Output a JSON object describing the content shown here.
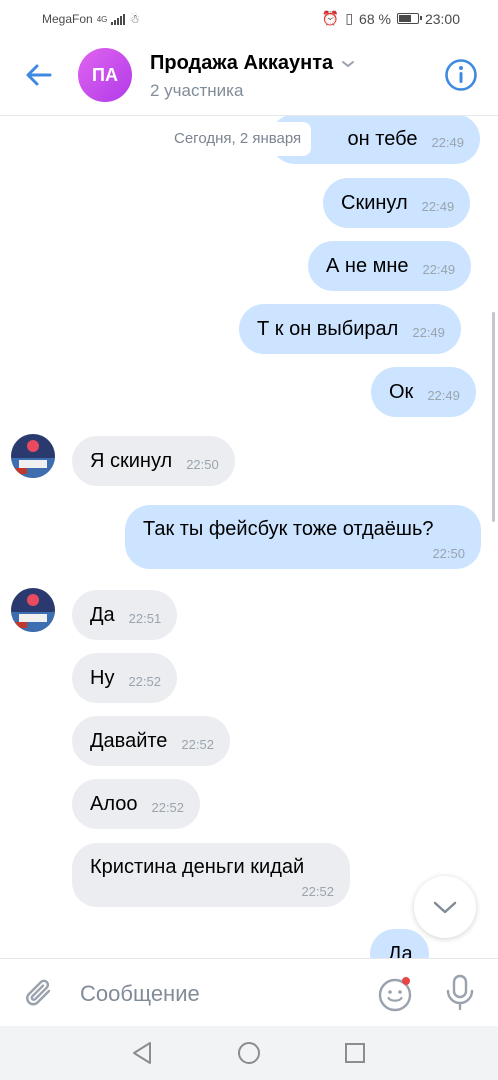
{
  "status_bar": {
    "carrier": "MegaFon",
    "network": "4G",
    "battery": "68 %",
    "time": "23:00"
  },
  "header": {
    "avatar_initials": "ПА",
    "title": "Продажа Аккаунта",
    "subtitle": "2 участника"
  },
  "date_separator": "Сегодня, 2 января",
  "messages": [
    {
      "text": "он тебе",
      "time": "22:49"
    },
    {
      "text": "Скинул",
      "time": "22:49"
    },
    {
      "text": "А не мне",
      "time": "22:49"
    },
    {
      "text": "Т к он выбирал",
      "time": "22:49"
    },
    {
      "text": "Ок",
      "time": "22:49"
    },
    {
      "text": "Я скинул",
      "time": "22:50"
    },
    {
      "text": "Так ты фейсбук тоже отдаёшь?",
      "time": "22:50"
    },
    {
      "text": "Да",
      "time": "22:51"
    },
    {
      "text": "Ну",
      "time": "22:52"
    },
    {
      "text": "Давайте",
      "time": "22:52"
    },
    {
      "text": "Алоо",
      "time": "22:52"
    },
    {
      "text": "Кристина деньги кидай",
      "time": "22:52"
    },
    {
      "text": "Да",
      "time": ""
    }
  ],
  "composer": {
    "placeholder": "Сообщение"
  },
  "colors": {
    "outgoing": "#cce4ff",
    "incoming": "#ebedf0",
    "accent": "#3f8ae0"
  }
}
